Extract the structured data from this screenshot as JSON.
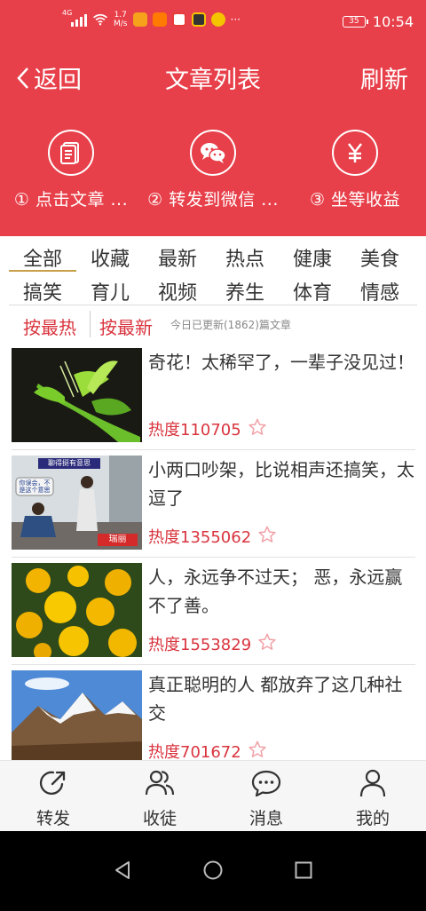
{
  "status_bar": {
    "network": "4G",
    "speed_value": "1.7",
    "speed_unit": "M/s",
    "more": "···",
    "battery": "35",
    "time": "10:54",
    "app_icon_colors": [
      "#f7a21b",
      "#ff7a00",
      "#e83b3b",
      "#333333",
      "#f4c400"
    ]
  },
  "header": {
    "back_label": "返回",
    "title": "文章列表",
    "refresh_label": "刷新",
    "bg_color": "#e8404a"
  },
  "steps": [
    {
      "icon": "document-icon",
      "label": "① 点击文章 ..."
    },
    {
      "icon": "wechat-icon",
      "label": "② 转发到微信 ..."
    },
    {
      "icon": "yen-icon",
      "label": "③ 坐等收益"
    }
  ],
  "categories": [
    "全部",
    "收藏",
    "最新",
    "热点",
    "健康",
    "美食",
    "搞笑",
    "育儿",
    "视频",
    "养生",
    "体育",
    "情感"
  ],
  "active_category": "全部",
  "sort": {
    "hot": "按最热",
    "new": "按最新",
    "info": "今日已更新(1862)篇文章"
  },
  "articles": [
    {
      "title": "奇花！太稀罕了，一辈子没见过！",
      "heat": "热度110705",
      "thumb": "green-flower-photo"
    },
    {
      "title": "小两口吵架，比说相声还搞笑，太逗了",
      "heat": "热度1355062",
      "thumb": "couple-comedy-photo"
    },
    {
      "title": "人，永远争不过天； 恶，永远赢不了善。",
      "heat": "热度1553829",
      "thumb": "yellow-marigold-photo"
    },
    {
      "title": "真正聪明的人 都放弃了这几种社交",
      "heat": "热度701672",
      "thumb": "snowy-mountain-photo"
    }
  ],
  "thumb_texts": {
    "couple_banner": "聊得挺有意思",
    "couple_bubble": "你误会，不是这个意思",
    "couple_logo": "瑞丽"
  },
  "bottom_nav": [
    {
      "icon": "share-icon",
      "label": "转发"
    },
    {
      "icon": "users-icon",
      "label": "收徒"
    },
    {
      "icon": "message-icon",
      "label": "消息"
    },
    {
      "icon": "user-icon",
      "label": "我的"
    }
  ],
  "colors": {
    "accent_red": "#e8404a",
    "heat_red": "#d9343e",
    "underline_gold": "#c8a04a"
  }
}
